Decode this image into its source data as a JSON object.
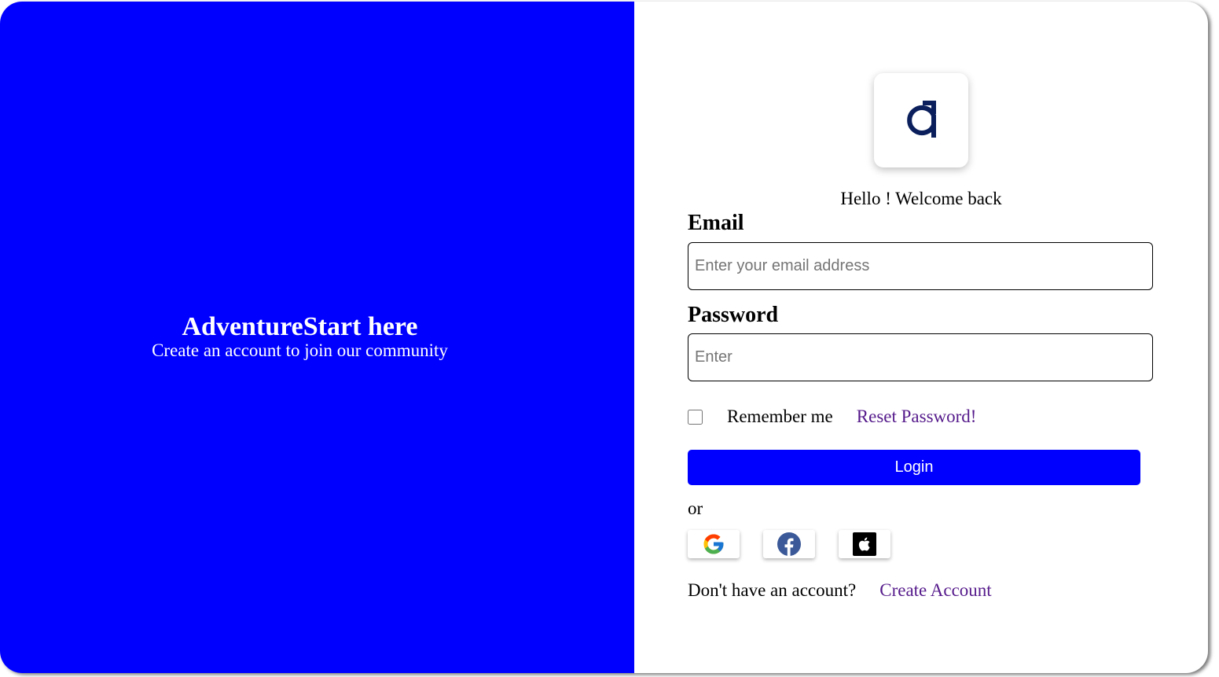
{
  "left_panel": {
    "title": "AdventureStart here",
    "subtitle": "Create an account to join our community",
    "background_color": "#0000ff"
  },
  "login_form": {
    "logo_icon": "brand-logo-icon",
    "welcome": "Hello ! Welcome back",
    "email_label": "Email",
    "email_placeholder": "Enter your email address",
    "email_value": "",
    "password_label": "Password",
    "password_placeholder": "Enter",
    "password_value": "",
    "remember_label": "Remember me",
    "remember_checked": false,
    "reset_link": "Reset Password!",
    "login_button": "Login",
    "or_text": "or",
    "social_buttons": [
      {
        "icon": "google-icon"
      },
      {
        "icon": "facebook-icon"
      },
      {
        "icon": "apple-icon"
      }
    ],
    "no_account_text": "Don't have an account?",
    "create_account_link": "Create Account"
  },
  "colors": {
    "accent": "#0000ff",
    "link": "#551a8b",
    "logo": "#0a1f5c"
  }
}
